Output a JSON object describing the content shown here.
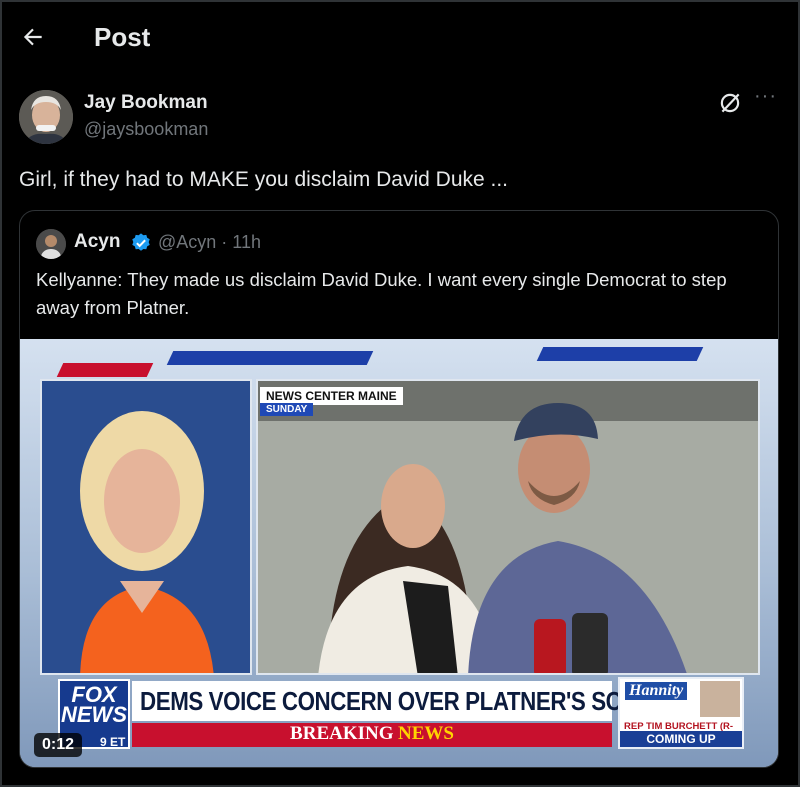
{
  "header": {
    "title": "Post"
  },
  "author": {
    "name": "Jay Bookman",
    "handle": "@jaysbookman"
  },
  "post": {
    "text": "Girl, if they had to MAKE you disclaim David Duke ..."
  },
  "quote": {
    "name": "Acyn",
    "handle": "@Acyn · 11h",
    "text": "Kellyanne: They made us disclaim David Duke. I want every single Democrat to step away from Platner.",
    "verified_color": "#1d9bf0"
  },
  "video": {
    "news_label": "NEWS CENTER MAINE",
    "news_sub": "SUNDAY",
    "fox_logo": "FOX NEWS",
    "chyron": "DEMS VOICE CONCERN OVER PLATNER'S SCANDALS",
    "breaking_a": "BREAKING",
    "breaking_b": "NEWS",
    "promo_show": "Hannity",
    "promo_guest": "REP TIM BURCHETT (R-TN)",
    "promo_status": "COMING UP",
    "time_zone": "9 ET",
    "timecode": "0:12"
  },
  "colors": {
    "background": "#000000",
    "text": "#e7e9ea",
    "muted": "#71767b",
    "border": "#2f3336"
  }
}
